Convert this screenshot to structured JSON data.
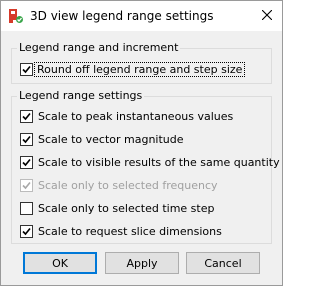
{
  "window": {
    "title": "3D view legend range settings",
    "icon": "app-logo-icon",
    "close_icon": "close-icon"
  },
  "group_increment": {
    "label": "Legend range and increment",
    "items": [
      {
        "label": "Round off legend range and step size",
        "checked": true,
        "enabled": true,
        "focused": true
      }
    ]
  },
  "group_settings": {
    "label": "Legend range settings",
    "items": [
      {
        "label": "Scale to peak instantaneous values",
        "checked": true,
        "enabled": true
      },
      {
        "label": "Scale to vector magnitude",
        "checked": true,
        "enabled": true
      },
      {
        "label": "Scale to visible results of the same quantity",
        "checked": true,
        "enabled": true
      },
      {
        "label": "Scale only to selected frequency",
        "checked": true,
        "enabled": false
      },
      {
        "label": "Scale only to selected time step",
        "checked": false,
        "enabled": true
      },
      {
        "label": "Scale to request slice dimensions",
        "checked": true,
        "enabled": true
      }
    ]
  },
  "buttons": {
    "ok": "OK",
    "apply": "Apply",
    "cancel": "Cancel"
  },
  "colors": {
    "accent": "#0078d7",
    "icon_red": "#d63a2a",
    "icon_green": "#3aa54a"
  }
}
